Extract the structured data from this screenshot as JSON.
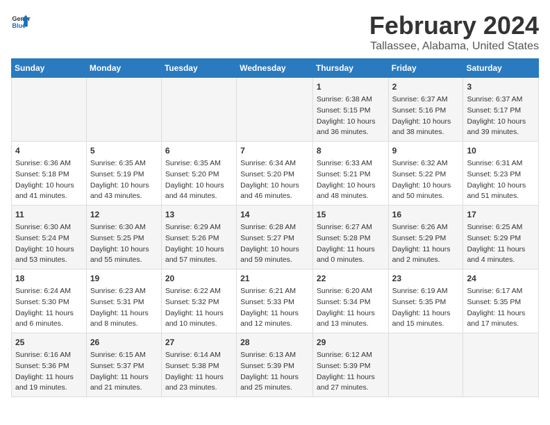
{
  "logo": {
    "text1": "General",
    "text2": "Blue"
  },
  "title": "February 2024",
  "subtitle": "Tallassee, Alabama, United States",
  "days_of_week": [
    "Sunday",
    "Monday",
    "Tuesday",
    "Wednesday",
    "Thursday",
    "Friday",
    "Saturday"
  ],
  "weeks": [
    [
      {
        "day": "",
        "info": ""
      },
      {
        "day": "",
        "info": ""
      },
      {
        "day": "",
        "info": ""
      },
      {
        "day": "",
        "info": ""
      },
      {
        "day": "1",
        "info": "Sunrise: 6:38 AM\nSunset: 5:15 PM\nDaylight: 10 hours\nand 36 minutes."
      },
      {
        "day": "2",
        "info": "Sunrise: 6:37 AM\nSunset: 5:16 PM\nDaylight: 10 hours\nand 38 minutes."
      },
      {
        "day": "3",
        "info": "Sunrise: 6:37 AM\nSunset: 5:17 PM\nDaylight: 10 hours\nand 39 minutes."
      }
    ],
    [
      {
        "day": "4",
        "info": "Sunrise: 6:36 AM\nSunset: 5:18 PM\nDaylight: 10 hours\nand 41 minutes."
      },
      {
        "day": "5",
        "info": "Sunrise: 6:35 AM\nSunset: 5:19 PM\nDaylight: 10 hours\nand 43 minutes."
      },
      {
        "day": "6",
        "info": "Sunrise: 6:35 AM\nSunset: 5:20 PM\nDaylight: 10 hours\nand 44 minutes."
      },
      {
        "day": "7",
        "info": "Sunrise: 6:34 AM\nSunset: 5:20 PM\nDaylight: 10 hours\nand 46 minutes."
      },
      {
        "day": "8",
        "info": "Sunrise: 6:33 AM\nSunset: 5:21 PM\nDaylight: 10 hours\nand 48 minutes."
      },
      {
        "day": "9",
        "info": "Sunrise: 6:32 AM\nSunset: 5:22 PM\nDaylight: 10 hours\nand 50 minutes."
      },
      {
        "day": "10",
        "info": "Sunrise: 6:31 AM\nSunset: 5:23 PM\nDaylight: 10 hours\nand 51 minutes."
      }
    ],
    [
      {
        "day": "11",
        "info": "Sunrise: 6:30 AM\nSunset: 5:24 PM\nDaylight: 10 hours\nand 53 minutes."
      },
      {
        "day": "12",
        "info": "Sunrise: 6:30 AM\nSunset: 5:25 PM\nDaylight: 10 hours\nand 55 minutes."
      },
      {
        "day": "13",
        "info": "Sunrise: 6:29 AM\nSunset: 5:26 PM\nDaylight: 10 hours\nand 57 minutes."
      },
      {
        "day": "14",
        "info": "Sunrise: 6:28 AM\nSunset: 5:27 PM\nDaylight: 10 hours\nand 59 minutes."
      },
      {
        "day": "15",
        "info": "Sunrise: 6:27 AM\nSunset: 5:28 PM\nDaylight: 11 hours\nand 0 minutes."
      },
      {
        "day": "16",
        "info": "Sunrise: 6:26 AM\nSunset: 5:29 PM\nDaylight: 11 hours\nand 2 minutes."
      },
      {
        "day": "17",
        "info": "Sunrise: 6:25 AM\nSunset: 5:29 PM\nDaylight: 11 hours\nand 4 minutes."
      }
    ],
    [
      {
        "day": "18",
        "info": "Sunrise: 6:24 AM\nSunset: 5:30 PM\nDaylight: 11 hours\nand 6 minutes."
      },
      {
        "day": "19",
        "info": "Sunrise: 6:23 AM\nSunset: 5:31 PM\nDaylight: 11 hours\nand 8 minutes."
      },
      {
        "day": "20",
        "info": "Sunrise: 6:22 AM\nSunset: 5:32 PM\nDaylight: 11 hours\nand 10 minutes."
      },
      {
        "day": "21",
        "info": "Sunrise: 6:21 AM\nSunset: 5:33 PM\nDaylight: 11 hours\nand 12 minutes."
      },
      {
        "day": "22",
        "info": "Sunrise: 6:20 AM\nSunset: 5:34 PM\nDaylight: 11 hours\nand 13 minutes."
      },
      {
        "day": "23",
        "info": "Sunrise: 6:19 AM\nSunset: 5:35 PM\nDaylight: 11 hours\nand 15 minutes."
      },
      {
        "day": "24",
        "info": "Sunrise: 6:17 AM\nSunset: 5:35 PM\nDaylight: 11 hours\nand 17 minutes."
      }
    ],
    [
      {
        "day": "25",
        "info": "Sunrise: 6:16 AM\nSunset: 5:36 PM\nDaylight: 11 hours\nand 19 minutes."
      },
      {
        "day": "26",
        "info": "Sunrise: 6:15 AM\nSunset: 5:37 PM\nDaylight: 11 hours\nand 21 minutes."
      },
      {
        "day": "27",
        "info": "Sunrise: 6:14 AM\nSunset: 5:38 PM\nDaylight: 11 hours\nand 23 minutes."
      },
      {
        "day": "28",
        "info": "Sunrise: 6:13 AM\nSunset: 5:39 PM\nDaylight: 11 hours\nand 25 minutes."
      },
      {
        "day": "29",
        "info": "Sunrise: 6:12 AM\nSunset: 5:39 PM\nDaylight: 11 hours\nand 27 minutes."
      },
      {
        "day": "",
        "info": ""
      },
      {
        "day": "",
        "info": ""
      }
    ]
  ]
}
